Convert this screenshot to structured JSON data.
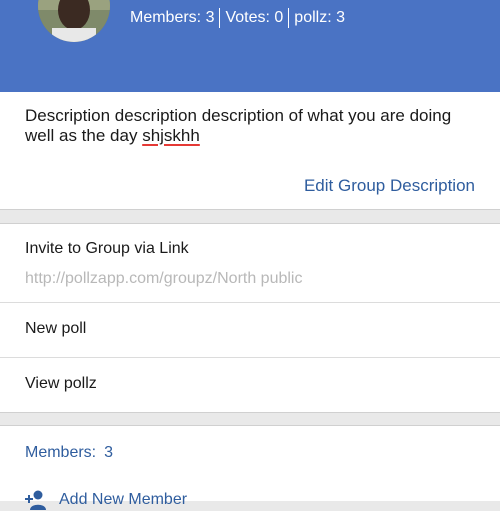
{
  "header": {
    "stats": {
      "members": "Members: 3",
      "votes": "Votes: 0",
      "pollz": "pollz: 3"
    }
  },
  "description": {
    "text_main": "Description description description of what you are doing well as the day ",
    "text_misspelled": "shjskhh",
    "edit_label": "Edit Group Description"
  },
  "invite": {
    "title": "Invite to Group via Link",
    "url": "http://pollzapp.com/groupz/North public"
  },
  "actions": {
    "new_poll": "New poll",
    "view_pollz": "View pollz"
  },
  "members": {
    "label": "Members:",
    "count": "3",
    "add_label": "Add New Member",
    "add_icon": "add-person-icon"
  },
  "colors": {
    "header_bg": "#4a73c4",
    "link": "#2f5d9e",
    "spell_underline": "#e53935"
  }
}
